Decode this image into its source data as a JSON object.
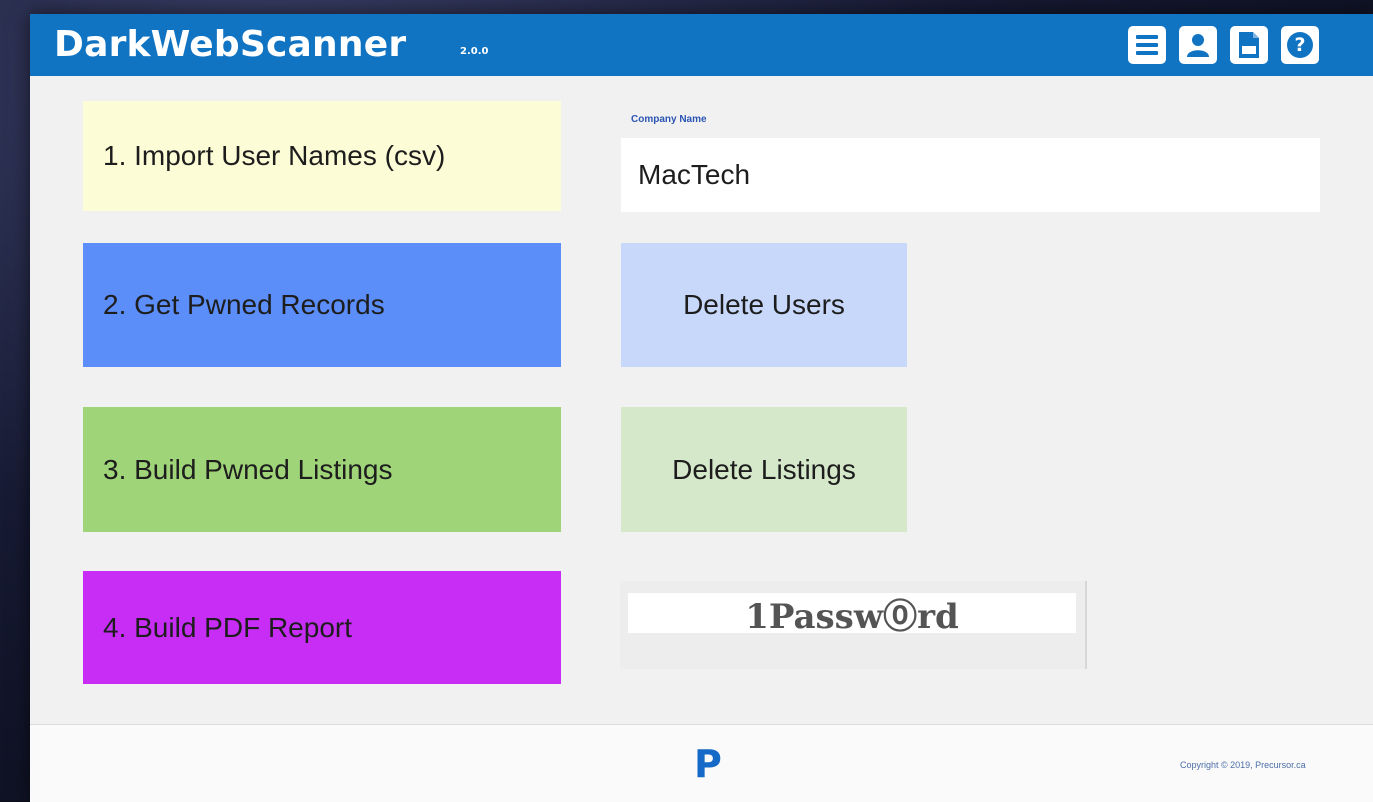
{
  "app": {
    "title": "DarkWebScanner",
    "version": "2.0.0"
  },
  "header_icons": [
    "menu-icon",
    "user-icon",
    "pdf-icon",
    "help-icon"
  ],
  "colors": {
    "header": "#1174c2",
    "import_button": "#fcfcd6",
    "pwned_button": "#5c8ef9",
    "listings_button": "#9fd478",
    "pdf_button": "#c72df5",
    "delete_users_button": "#c7d8fb",
    "delete_listings_button": "#d6e8ca"
  },
  "actions": {
    "import_label": "1. Import User Names (csv)",
    "get_pwned_label": "2. Get Pwned Records",
    "build_listings_label": "3. Build Pwned Listings",
    "build_pdf_label": "4. Build PDF Report",
    "delete_users_label": "Delete Users",
    "delete_listings_label": "Delete Listings"
  },
  "company": {
    "label": "Company Name",
    "value": "MacTech"
  },
  "onepassword": {
    "logo_text": "1Passw⓪rd"
  },
  "footer": {
    "logo": "P",
    "copyright": "Copyright © 2019, Precursor.ca"
  }
}
